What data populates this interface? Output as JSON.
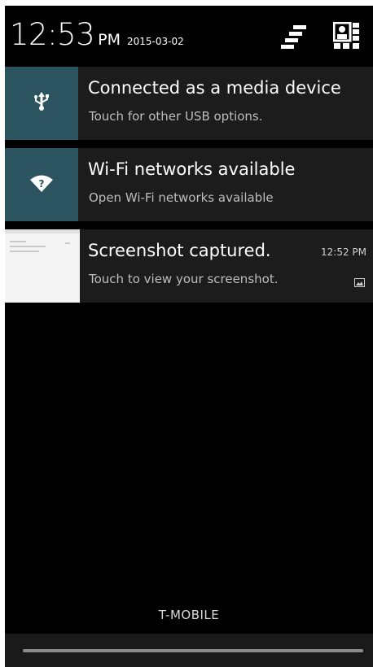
{
  "header": {
    "time": "12:53",
    "ampm": "PM",
    "date": "2015-03-02",
    "clear_icon": "clear-all-icon",
    "quick_settings_icon": "quick-settings-icon"
  },
  "notifications": [
    {
      "title": "Connected as a media device",
      "subtitle": "Touch for other USB options.",
      "icon": "usb-icon"
    },
    {
      "title": "Wi-Fi networks available",
      "subtitle": "Open Wi-Fi networks available",
      "icon": "wifi-question-icon"
    },
    {
      "title": "Screenshot captured.",
      "subtitle": "Touch to view your screenshot.",
      "time": "12:52 PM",
      "icon": "screenshot-thumbnail",
      "small_icon": "image-icon"
    }
  ],
  "footer": {
    "carrier": "T-MOBILE"
  },
  "colors": {
    "background": "#000000",
    "notification_bg": "#1c1c1c",
    "icon_tile": "#2b5460"
  }
}
